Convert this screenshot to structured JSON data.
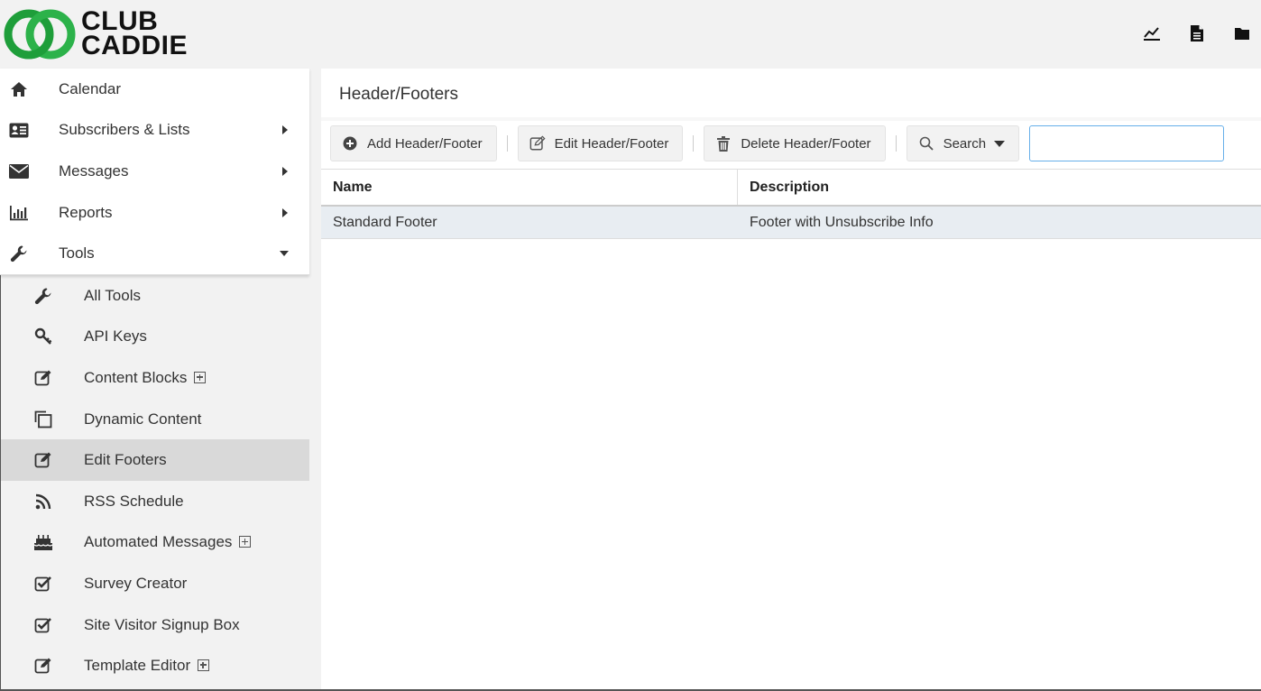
{
  "brand": {
    "line1": "CLUB",
    "line2": "CADDIE",
    "ring_color": "#22a33a"
  },
  "top_icons": [
    "line-chart-icon",
    "document-icon",
    "folder-icon"
  ],
  "sidebar": {
    "main_items": [
      {
        "label": "Calendar",
        "icon": "home-icon",
        "arrow": "none"
      },
      {
        "label": "Subscribers & Lists",
        "icon": "contact-card-icon",
        "arrow": "right"
      },
      {
        "label": "Messages",
        "icon": "envelope-icon",
        "arrow": "right"
      },
      {
        "label": "Reports",
        "icon": "bar-chart-icon",
        "arrow": "right"
      },
      {
        "label": "Tools",
        "icon": "wrench-icon",
        "arrow": "down"
      }
    ],
    "sub_items": [
      {
        "label": "All Tools",
        "icon": "wrench-icon"
      },
      {
        "label": "API Keys",
        "icon": "key-icon"
      },
      {
        "label": "Content Blocks",
        "icon": "edit-icon",
        "expandable": true
      },
      {
        "label": "Dynamic Content",
        "icon": "copy-icon"
      },
      {
        "label": "Edit Footers",
        "icon": "edit-icon",
        "active": true
      },
      {
        "label": "RSS Schedule",
        "icon": "rss-icon"
      },
      {
        "label": "Automated Messages",
        "icon": "cake-icon",
        "expandable": true
      },
      {
        "label": "Survey Creator",
        "icon": "checkbox-icon"
      },
      {
        "label": "Site Visitor Signup Box",
        "icon": "checkbox-icon"
      },
      {
        "label": "Template Editor",
        "icon": "edit-icon",
        "expandable": true
      }
    ]
  },
  "main": {
    "title": "Header/Footers",
    "toolbar": {
      "add_label": "Add Header/Footer",
      "edit_label": "Edit Header/Footer",
      "delete_label": "Delete Header/Footer",
      "search_label": "Search",
      "search_value": ""
    },
    "table": {
      "columns": [
        "Name",
        "Description"
      ],
      "rows": [
        {
          "name": "Standard Footer",
          "description": "Footer with Unsubscribe Info"
        }
      ]
    }
  }
}
